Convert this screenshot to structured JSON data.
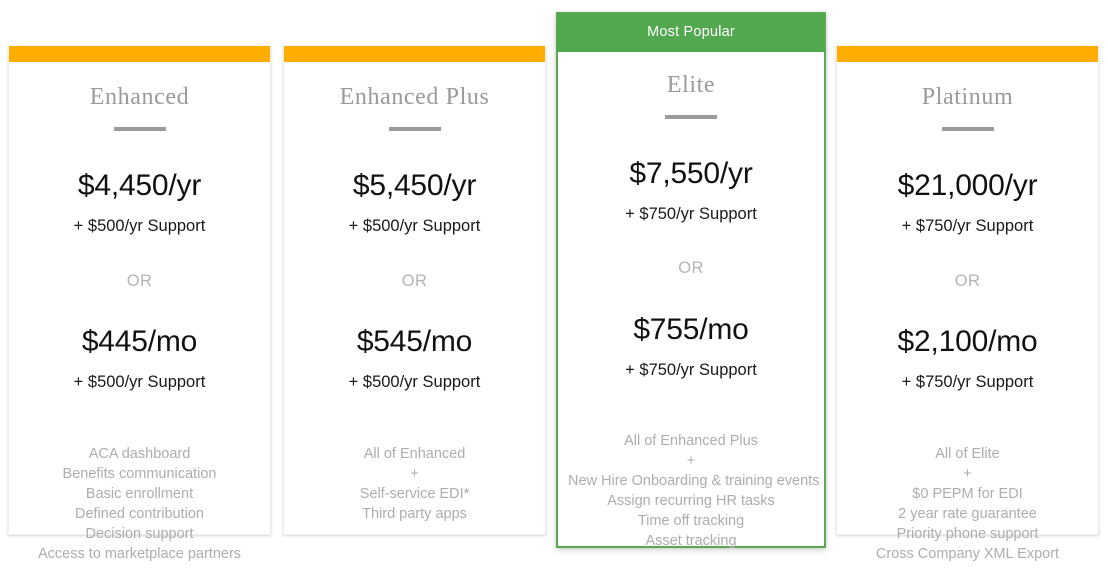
{
  "theme": {
    "accent_orange": "#ffae00",
    "accent_green": "#52a84e",
    "featured_border": "#5aa84f",
    "price_color": "#111111",
    "muted_text": "#adadad",
    "plan_name_color": "#9a9a9a",
    "or_color": "#b4b4b4",
    "card_background": "#ffffff",
    "page_background": "#ffffff"
  },
  "labels": {
    "or": "OR",
    "plus": "+",
    "most_popular": "Most Popular"
  },
  "plans": [
    {
      "name": "Enhanced",
      "featured": false,
      "badge": "",
      "price_yearly": "$4,450/yr",
      "support_yearly": "+ $500/yr Support",
      "or": "OR",
      "price_monthly": "$445/mo",
      "support_monthly": "+ $500/yr Support",
      "features": [
        "ACA dashboard",
        "Benefits communication",
        "Basic enrollment",
        "Defined contribution",
        "Decision support",
        "Access to marketplace partners"
      ]
    },
    {
      "name": "Enhanced Plus",
      "featured": false,
      "badge": "",
      "price_yearly": "$5,450/yr",
      "support_yearly": "+ $500/yr Support",
      "or": "OR",
      "price_monthly": "$545/mo",
      "support_monthly": "+ $500/yr Support",
      "features": [
        "All of Enhanced",
        "+",
        "Self-service EDI*",
        "Third party apps"
      ]
    },
    {
      "name": "Elite",
      "featured": true,
      "badge": "Most Popular",
      "price_yearly": "$7,550/yr",
      "support_yearly": "+ $750/yr Support",
      "or": "OR",
      "price_monthly": "$755/mo",
      "support_monthly": "+ $750/yr Support",
      "features": [
        "All of Enhanced Plus",
        "+",
        "New Hire Onboarding & training events",
        "Assign recurring HR tasks",
        "Time off tracking",
        "Asset tracking"
      ]
    },
    {
      "name": "Platinum",
      "featured": false,
      "badge": "",
      "price_yearly": "$21,000/yr",
      "support_yearly": "+ $750/yr Support",
      "or": "OR",
      "price_monthly": "$2,100/mo",
      "support_monthly": "+ $750/yr Support",
      "features": [
        "All of Elite",
        "+",
        "$0 PEPM for EDI",
        "2 year rate guarantee",
        "Priority phone support",
        "Cross Company XML Export"
      ]
    }
  ]
}
